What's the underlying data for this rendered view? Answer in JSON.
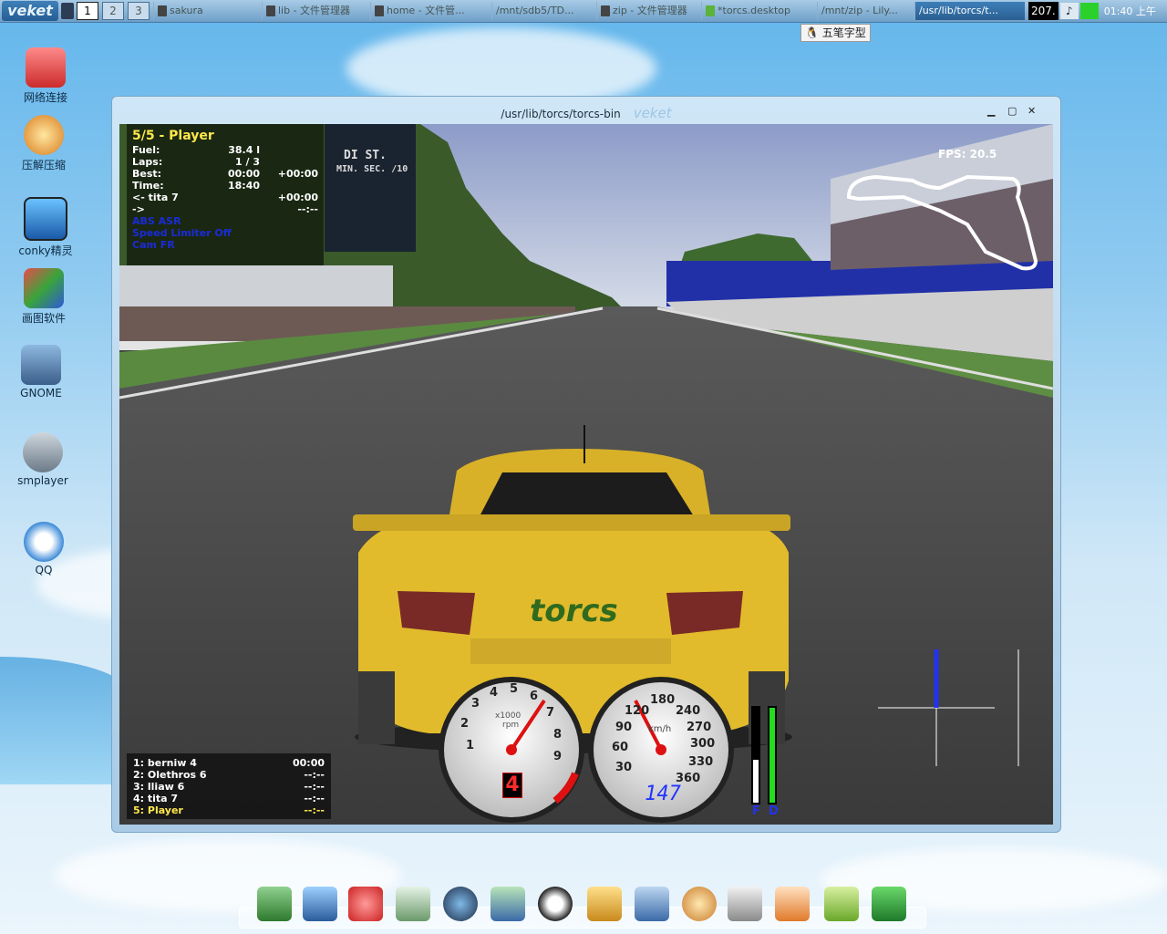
{
  "taskbar": {
    "logo": "veket",
    "workspaces": [
      "1",
      "2",
      "3"
    ],
    "tasks": [
      "sakura",
      "lib - 文件管理器",
      "home - 文件管...",
      "/mnt/sdb5/TD...",
      "zip - 文件管理器",
      "*torcs.desktop",
      "/mnt/zip - Lily...",
      "/usr/lib/torcs/t..."
    ],
    "cpu": "207.",
    "clock": "01:40 上午"
  },
  "ime": "五笔字型",
  "desktop_icons": [
    "网络连接",
    "压解压缩",
    "conky精灵",
    "画图软件",
    "GNOME",
    "smplayer",
    "QQ"
  ],
  "window": {
    "title": "/usr/lib/torcs/torcs-bin",
    "brand": "veket",
    "controls": [
      "▁",
      "▢",
      "✕"
    ]
  },
  "hud": {
    "position": "5/5 - Player",
    "fuel_label": "Fuel:",
    "fuel": "38.4 l",
    "laps_label": "Laps:",
    "laps": "1 / 3",
    "best_label": "Best:",
    "best": "00:00",
    "best_diff": "+00:00",
    "time_label": "Time:",
    "time": "18:40",
    "prev_label": "<- tita 7",
    "prev_diff": "+00:00",
    "next_label": "->",
    "next_diff": "--:--",
    "abs": "ABS ASR",
    "speed_limiter": "Speed Limiter Off",
    "cam": "Cam FR",
    "fps": "FPS: 20.5",
    "board_text": [
      "DI ST.",
      "MIN. SEC. /10"
    ],
    "standings": [
      {
        "label": "1: berniw 4",
        "time": "00:00"
      },
      {
        "label": "2: Olethros 6",
        "time": "--:--"
      },
      {
        "label": "3: lliaw 6",
        "time": "--:--"
      },
      {
        "label": "4: tita 7",
        "time": "--:--"
      },
      {
        "label": "5: Player",
        "time": "--:--"
      }
    ],
    "rpm_ticks": [
      "1",
      "2",
      "3",
      "4",
      "5",
      "6",
      "7",
      "8",
      "9"
    ],
    "rpm_unit": "x1000",
    "rpm_unit2": "rpm",
    "gear": "4",
    "speed_ticks": [
      "30",
      "60",
      "90",
      "120",
      "180",
      "240",
      "270",
      "300",
      "330",
      "360"
    ],
    "speed_unit": "km/h",
    "speed": "147",
    "fuel_bar_label": "F",
    "damage_bar_label": "D",
    "car_logo": "torcs",
    "fuel_level": 0.45,
    "damage_level": 1.0
  },
  "colors": {
    "car": "#e8c12e",
    "hud_highlight": "#ffe84a",
    "hud_blue": "#1a2bd8",
    "rpm_needle": "#e01818",
    "taskbar_active": "#2a5f92"
  }
}
